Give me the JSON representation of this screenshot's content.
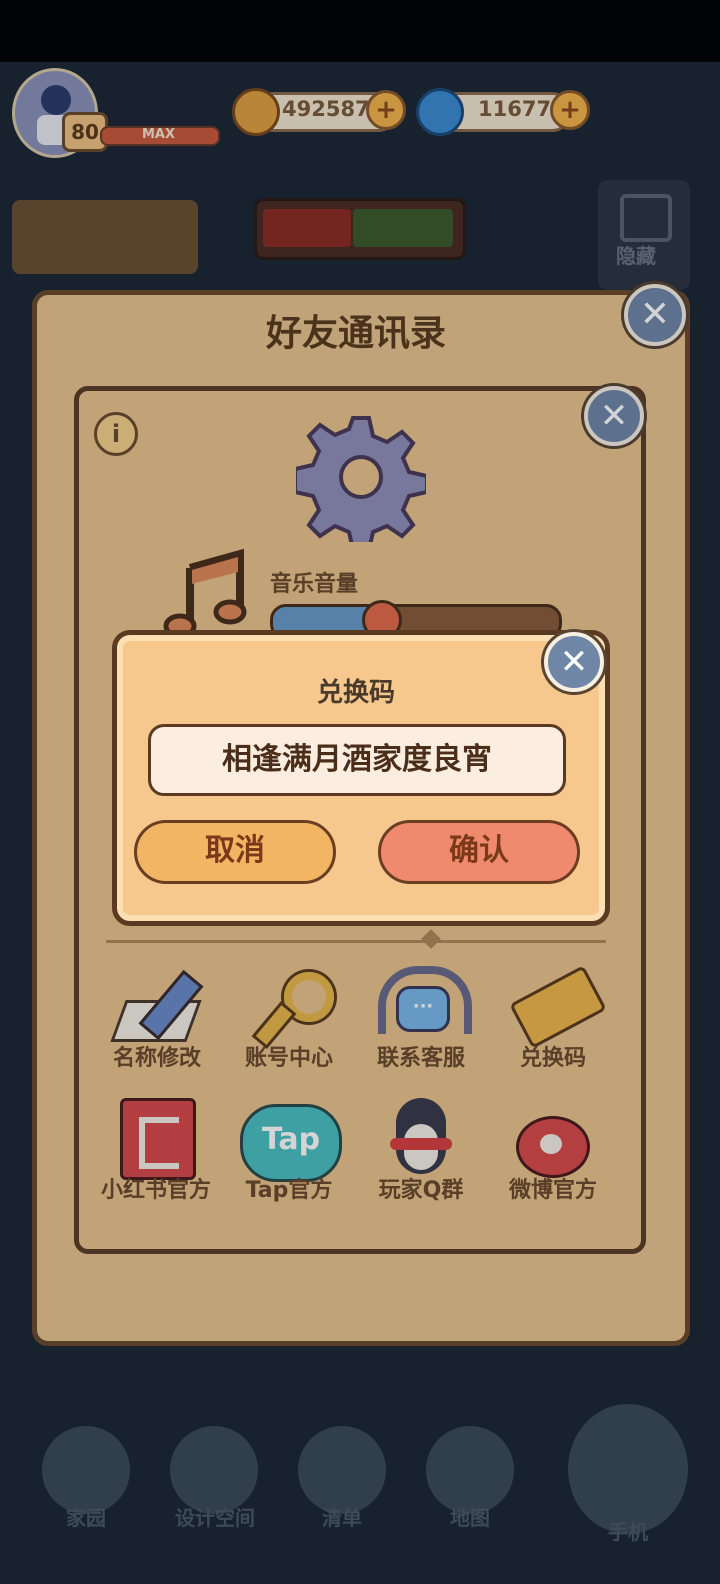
{
  "hud": {
    "level": "80",
    "level_max": "MAX",
    "coins": "492587",
    "gems": "11677"
  },
  "background": {
    "title": "好友通讯录",
    "hide_label": "隐藏"
  },
  "settings": {
    "music_label": "音乐音量",
    "music_volume": 0.38
  },
  "redeem": {
    "title": "兑换码",
    "code": "相逢满月酒家度良宵",
    "cancel": "取消",
    "confirm": "确认"
  },
  "menu": [
    {
      "label": "名称修改",
      "icon": "pencil-icon"
    },
    {
      "label": "账号中心",
      "icon": "key-icon"
    },
    {
      "label": "联系客服",
      "icon": "headset-icon"
    },
    {
      "label": "兑换码",
      "icon": "ticket-icon"
    },
    {
      "label": "小红书官方",
      "icon": "red-book-icon"
    },
    {
      "label": "Tap官方",
      "icon": "tap-icon"
    },
    {
      "label": "玩家Q群",
      "icon": "penguin-icon"
    },
    {
      "label": "微博官方",
      "icon": "weibo-icon"
    }
  ],
  "bottom_nav": [
    "家园",
    "设计空间",
    "清单",
    "地图",
    "手机"
  ],
  "colors": {
    "panel": "#e8c48d",
    "dialog": "#f6c88e",
    "confirm": "#ef8a6e",
    "cancel": "#f2b563"
  }
}
